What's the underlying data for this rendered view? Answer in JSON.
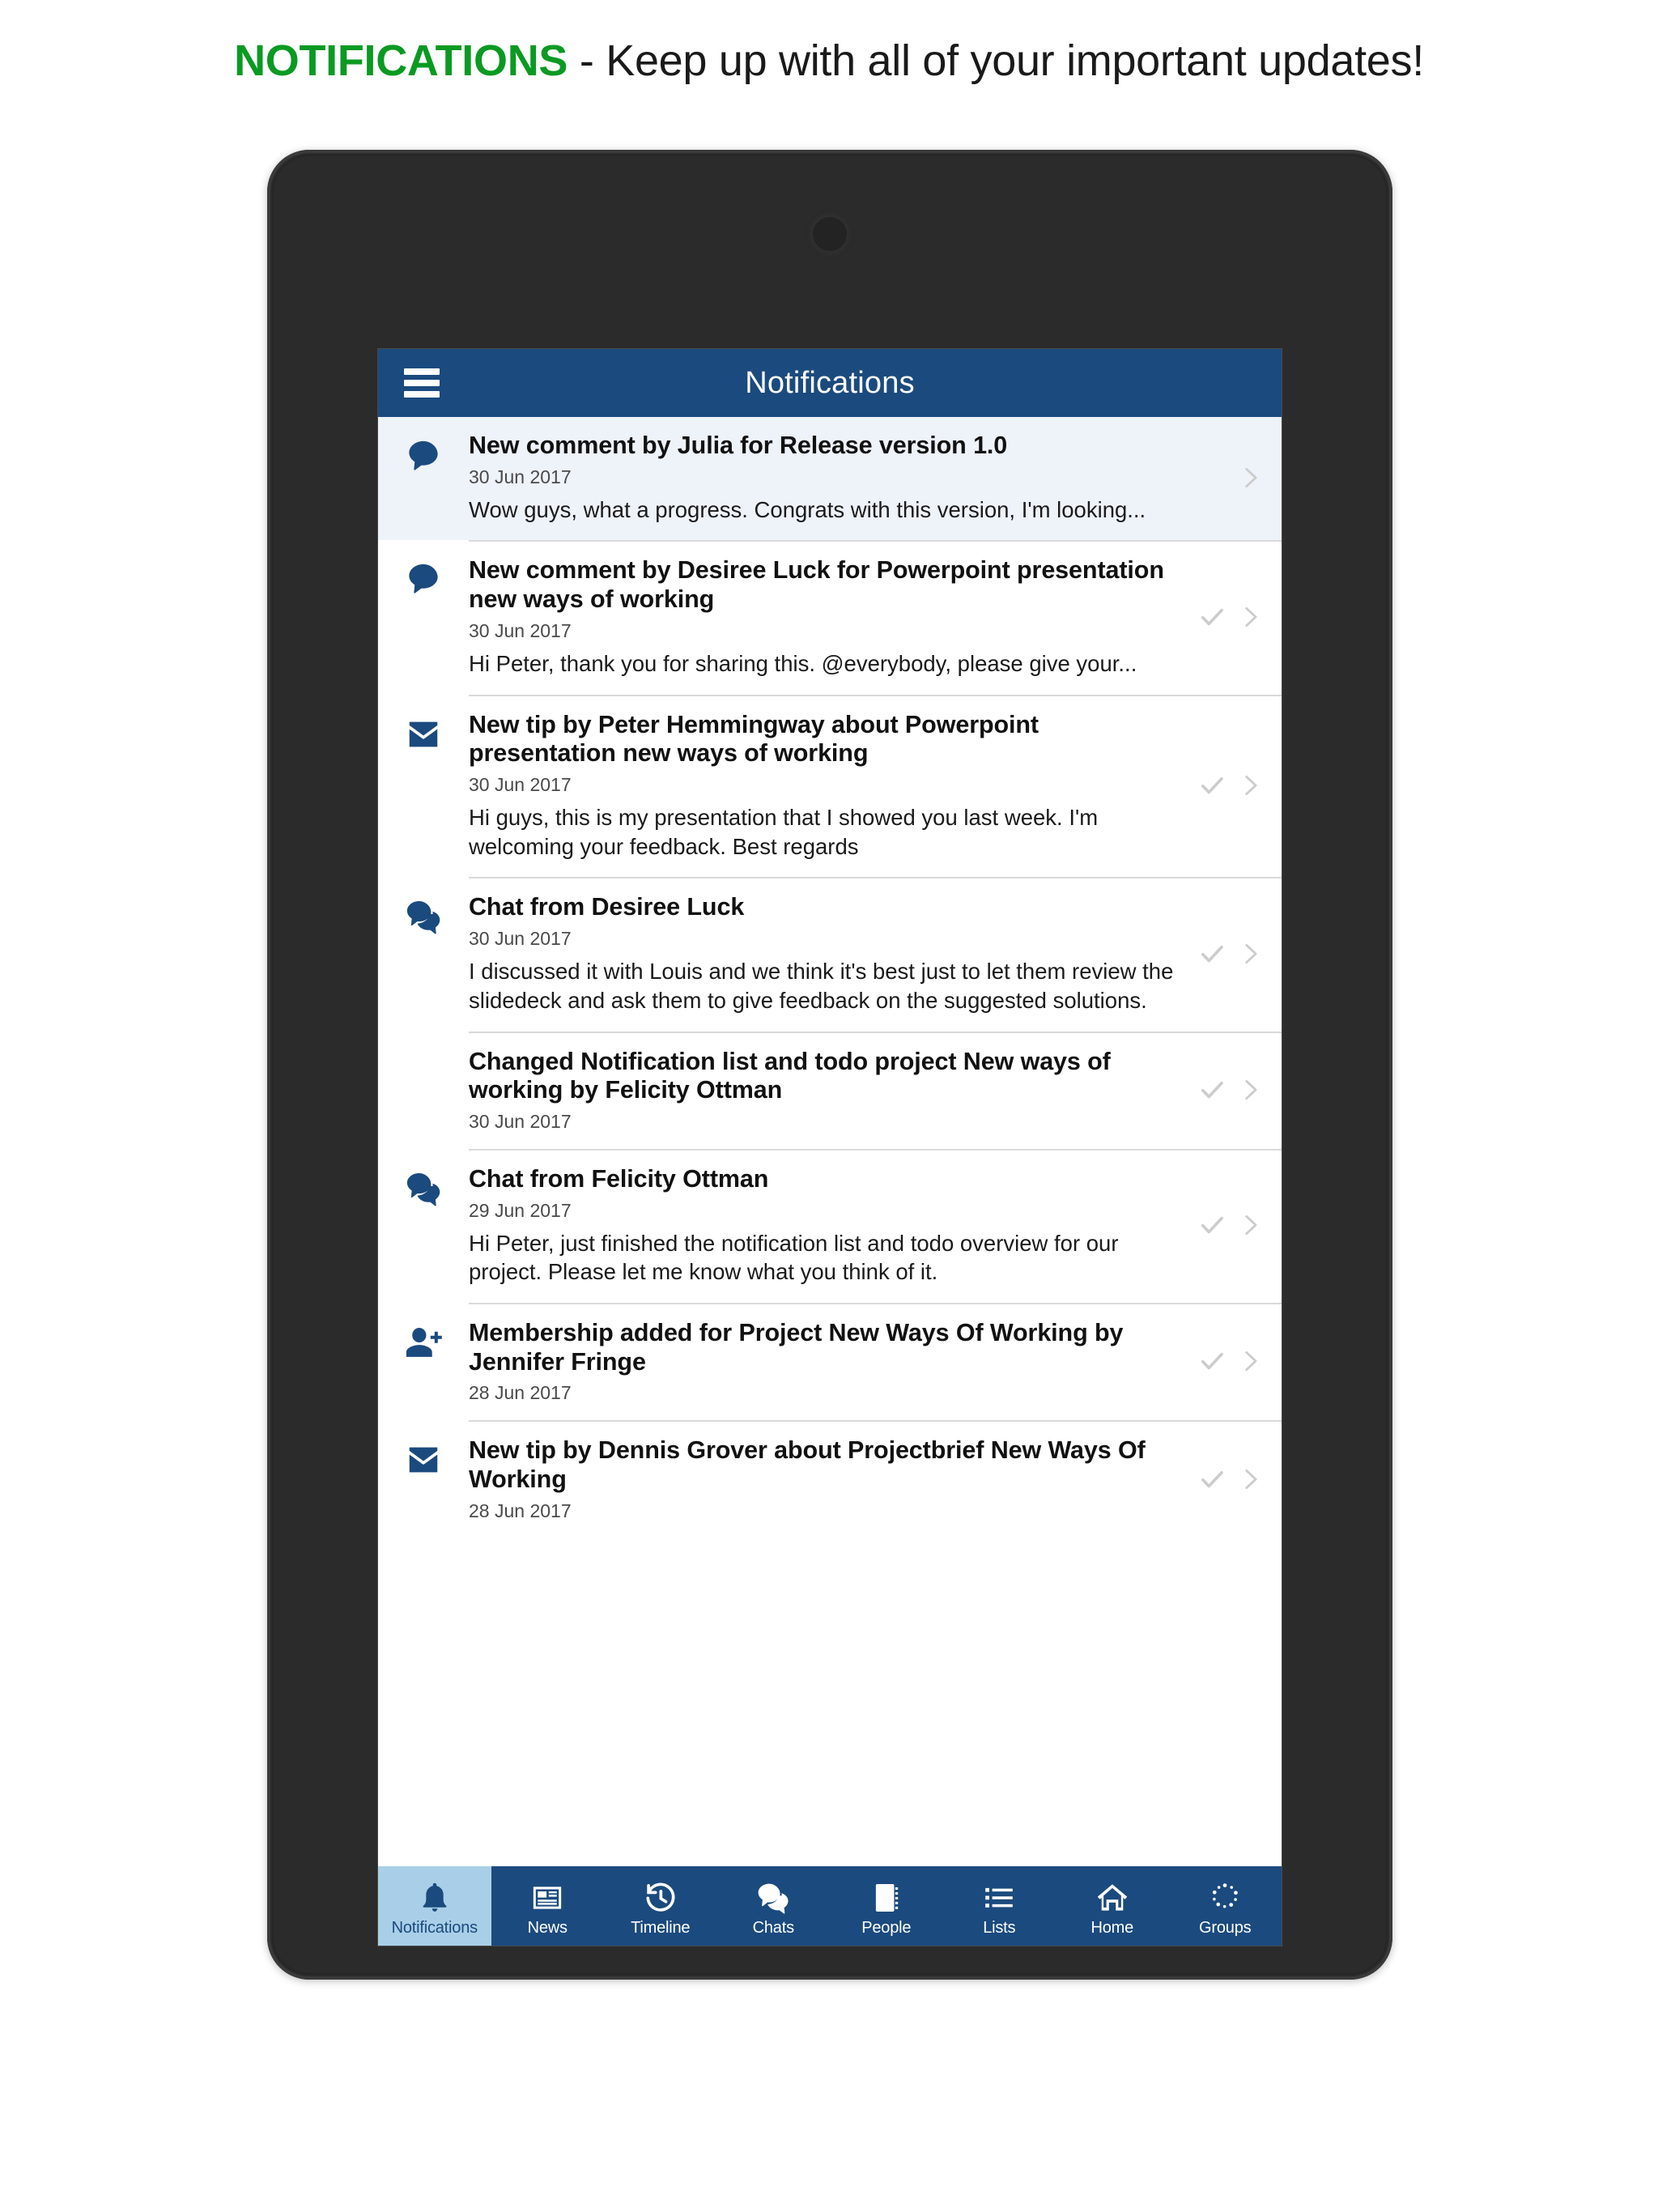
{
  "promo": {
    "strong": "NOTIFICATIONS",
    "rest": " - Keep up with all of your important updates!"
  },
  "colors": {
    "brand_blue": "#1b4a7e",
    "active_tab_bg": "#a9cfe8",
    "unread_row_bg": "#eef2f9",
    "promo_green": "#0a9a22",
    "muted_icon": "#cccccc"
  },
  "appbar": {
    "title": "Notifications",
    "menu_icon": "hamburger-menu-icon"
  },
  "notifications": [
    {
      "icon": "speech-bubble-icon",
      "title": "New comment by Julia for Release version 1.0",
      "date": "30 Jun 2017",
      "snippet": "Wow guys, what a progress. Congrats with this version, I'm looking...",
      "unread": true,
      "has_check": false,
      "has_chevron": true
    },
    {
      "icon": "speech-bubble-icon",
      "title": "New comment by Desiree Luck for Powerpoint presentation new ways of working",
      "date": "30 Jun 2017",
      "snippet": "Hi Peter, thank you for sharing this. @everybody, please give your...",
      "unread": false,
      "has_check": true,
      "has_chevron": true
    },
    {
      "icon": "envelope-icon",
      "title": "New tip by Peter Hemmingway about Powerpoint presentation new ways of working",
      "date": "30 Jun 2017",
      "snippet": "Hi guys, this is my presentation that I showed you last week. I'm welcoming your feedback. Best regards",
      "unread": false,
      "has_check": true,
      "has_chevron": true
    },
    {
      "icon": "chat-bubbles-icon",
      "title": "Chat from Desiree Luck",
      "date": "30 Jun 2017",
      "snippet": "I discussed it with Louis and we think it's best just to let them review the slidedeck and ask them to give feedback on the suggested solutions.",
      "unread": false,
      "has_check": true,
      "has_chevron": true
    },
    {
      "icon": "none",
      "title": "Changed Notification list and todo project New ways of working by Felicity Ottman",
      "date": "30 Jun 2017",
      "snippet": "",
      "unread": false,
      "has_check": true,
      "has_chevron": true
    },
    {
      "icon": "chat-bubbles-icon",
      "title": "Chat from Felicity Ottman",
      "date": "29 Jun 2017",
      "snippet": "Hi Peter, just finished the notification list and todo overview for our project. Please let me know what you think of it.",
      "unread": false,
      "has_check": true,
      "has_chevron": true
    },
    {
      "icon": "person-add-icon",
      "title": "Membership added for Project New Ways Of Working by Jennifer Fringe",
      "date": "28 Jun 2017",
      "snippet": "",
      "unread": false,
      "has_check": true,
      "has_chevron": true
    },
    {
      "icon": "envelope-icon",
      "title": "New tip by Dennis Grover about Projectbrief New Ways Of Working",
      "date": "28 Jun 2017",
      "snippet": "",
      "unread": false,
      "has_check": true,
      "has_chevron": true
    }
  ],
  "tabs": [
    {
      "label": "Notifications",
      "icon": "bell-icon",
      "active": true
    },
    {
      "label": "News",
      "icon": "newspaper-icon",
      "active": false
    },
    {
      "label": "Timeline",
      "icon": "history-clock-icon",
      "active": false
    },
    {
      "label": "Chats",
      "icon": "chat-bubbles-icon",
      "active": false
    },
    {
      "label": "People",
      "icon": "contact-card-icon",
      "active": false
    },
    {
      "label": "Lists",
      "icon": "list-icon",
      "active": false
    },
    {
      "label": "Home",
      "icon": "home-icon",
      "active": false
    },
    {
      "label": "Groups",
      "icon": "dotted-circle-icon",
      "active": false
    }
  ]
}
